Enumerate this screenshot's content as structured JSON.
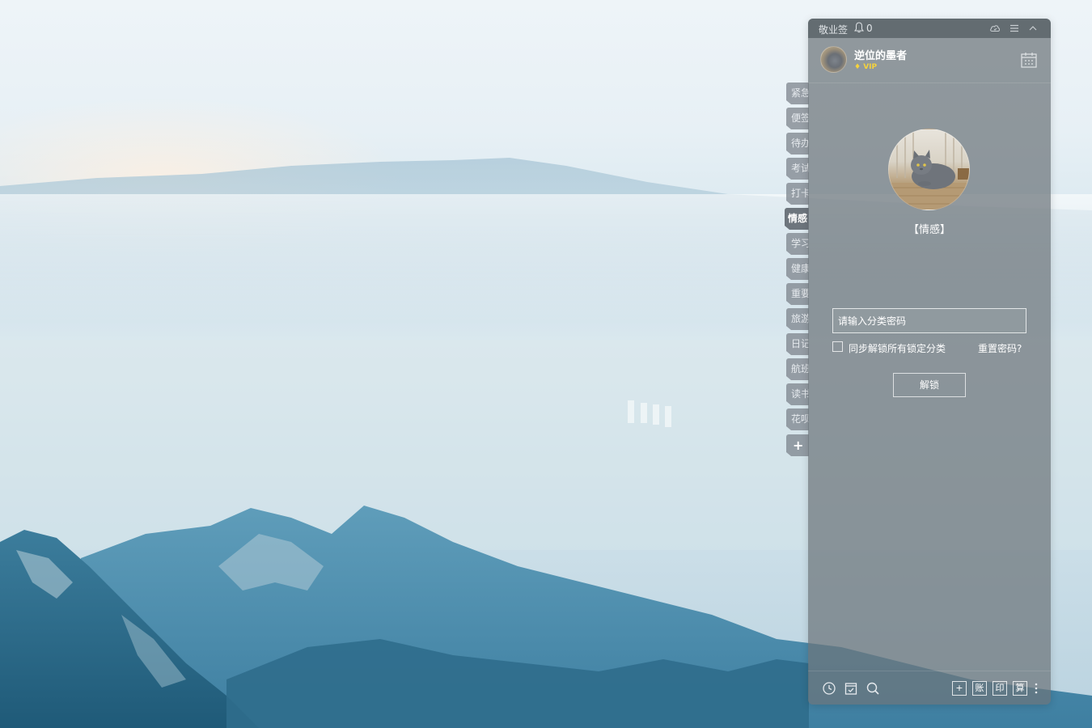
{
  "app": {
    "title": "敬业签",
    "notification_count": "0"
  },
  "user": {
    "name": "逆位的墨者",
    "badge": "VIP"
  },
  "side_tabs": [
    "紧急",
    "便签",
    "待办",
    "考试",
    "打卡",
    "情感",
    "学习",
    "健康",
    "重要",
    "旅游",
    "日记",
    "航班",
    "读书",
    "花呗"
  ],
  "active_tab": "情感",
  "add_tab_label": "+",
  "lock": {
    "category_label": "【情感】",
    "password_placeholder": "请输入分类密码",
    "sync_label": "同步解锁所有锁定分类",
    "reset_link": "重置密码?",
    "unlock_button": "解锁"
  },
  "footer": {
    "box_buttons": [
      "+",
      "账",
      "印",
      "算"
    ],
    "icons": [
      "clock-icon",
      "check-calendar-icon",
      "search-icon",
      "more-icon"
    ]
  },
  "titlebar_icons": [
    "cloud-sync-icon",
    "menu-icon",
    "collapse-icon"
  ],
  "colors": {
    "panel": "#6c747a",
    "vip": "#f5d23c",
    "text": "#ffffff"
  }
}
